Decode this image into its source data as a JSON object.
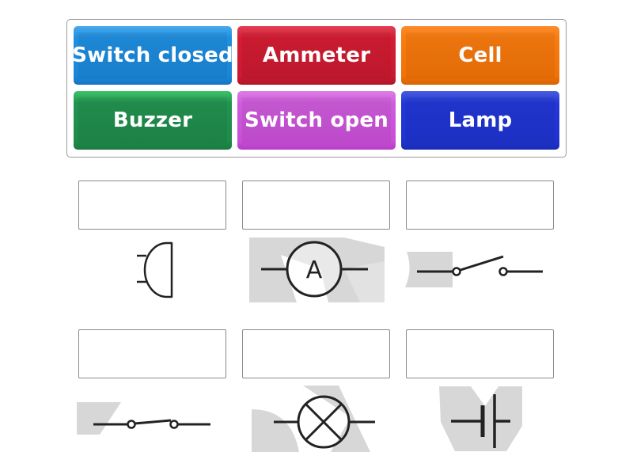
{
  "tiles": [
    {
      "label": "Switch closed",
      "color": "#1f8fe0"
    },
    {
      "label": "Ammeter",
      "color": "#d41d33"
    },
    {
      "label": "Cell",
      "color": "#f97c10"
    },
    {
      "label": "Buzzer",
      "color": "#239350"
    },
    {
      "label": "Switch open",
      "color": "#cf5cdc"
    },
    {
      "label": "Lamp",
      "color": "#2237d6"
    }
  ],
  "slots": [
    {
      "value": "",
      "symbol": "buzzer-symbol"
    },
    {
      "value": "",
      "symbol": "ammeter-symbol",
      "symbol_text": "A"
    },
    {
      "value": "",
      "symbol": "switch-open-symbol"
    },
    {
      "value": "",
      "symbol": "switch-closed-symbol"
    },
    {
      "value": "",
      "symbol": "lamp-symbol"
    },
    {
      "value": "",
      "symbol": "cell-symbol"
    }
  ]
}
